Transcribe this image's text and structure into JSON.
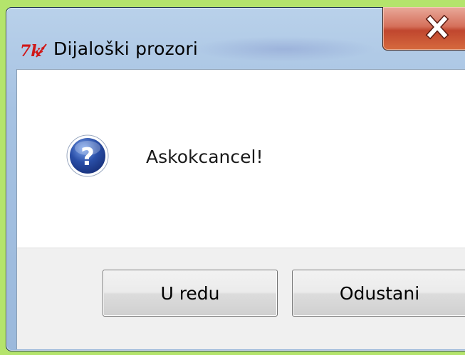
{
  "window": {
    "title": "Dijaloški prozori",
    "app_icon": "tk-feather-icon",
    "close_icon": "close-icon",
    "close_button_color": "#c0462e"
  },
  "dialog": {
    "icon": "question-icon",
    "icon_color": "#2a4fa8",
    "message": "Askokcancel!"
  },
  "buttons": {
    "ok_label": "U redu",
    "cancel_label": "Odustani"
  }
}
